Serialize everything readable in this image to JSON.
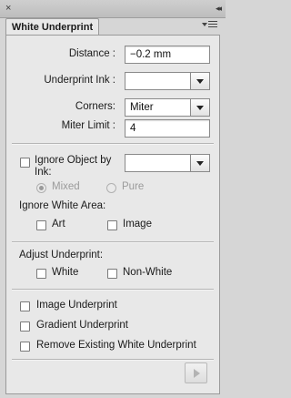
{
  "window": {
    "close_glyph": "×",
    "collapse_glyph": "◂◂"
  },
  "tab": {
    "title": "White Underprint"
  },
  "distance": {
    "label": "Distance :",
    "value": "−0.2 mm"
  },
  "underprint_ink": {
    "label": "Underprint Ink :",
    "value": ""
  },
  "corners": {
    "label": "Corners:",
    "value": "Miter"
  },
  "miter_limit": {
    "label": "Miter Limit :",
    "value": "4"
  },
  "ignore_object": {
    "label_line1": "Ignore Object by",
    "label_line2": "Ink:",
    "value": "",
    "checked": false,
    "options": [
      {
        "label": "Mixed",
        "selected": true
      },
      {
        "label": "Pure",
        "selected": false
      }
    ]
  },
  "ignore_white_area": {
    "heading": "Ignore White Area:",
    "art_label": "Art",
    "image_label": "Image"
  },
  "adjust_underprint": {
    "heading": "Adjust Underprint:",
    "white_label": "White",
    "nonwhite_label": "Non-White"
  },
  "options": {
    "image_underprint": "Image Underprint",
    "gradient_underprint": "Gradient Underprint",
    "remove_existing": "Remove Existing White Underprint"
  }
}
